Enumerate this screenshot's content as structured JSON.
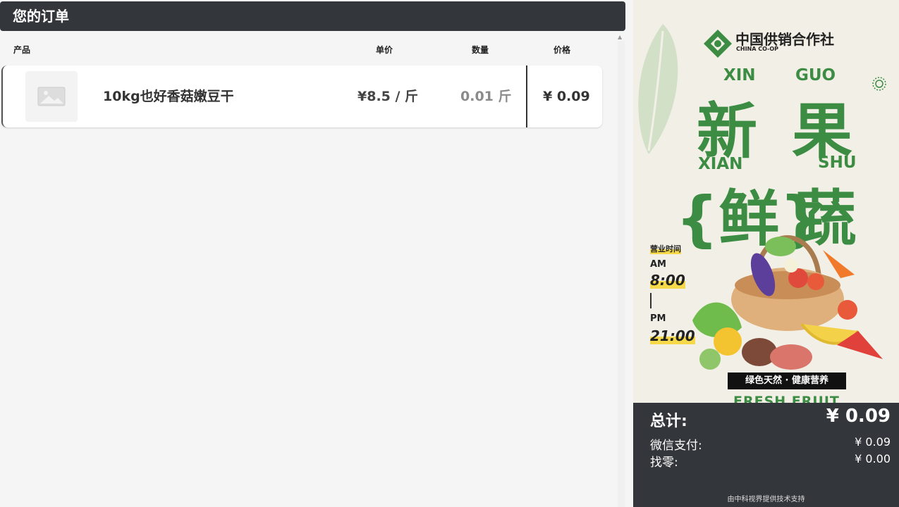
{
  "order": {
    "title": "您的订单",
    "columns": {
      "product": "产品",
      "unit_price": "单价",
      "quantity": "数量",
      "price": "价格"
    },
    "items": [
      {
        "name": "10kg也好香菇嫩豆干",
        "unit_price": "¥8.5 / 斤",
        "quantity": "0.01 斤",
        "price": "¥ 0.09",
        "image_icon": "image-placeholder-icon"
      }
    ]
  },
  "poster": {
    "brand_cn": "中国供销合作社",
    "brand_en": "CHINA CO-OP",
    "pinyin_xin": "XIN",
    "pinyin_guo": "GUO",
    "char_xin": "新",
    "char_guo": "果",
    "pinyin_xian": "XIAN",
    "pinyin_shu": "SHU",
    "char_xian": "{鲜}",
    "char_shu": "蔬",
    "hours_title": "营业时间",
    "am_label": "AM",
    "am_time": "8:00",
    "pm_label": "PM",
    "pm_time": "21:00",
    "slogan": "绿色天然 · 健康营养",
    "fresh_fruit": "FRESH FRUIT",
    "accent_color": "#3d8c44"
  },
  "summary": {
    "total_label": "总计:",
    "total_value": "¥ 0.09",
    "wechat_label": "微信支付:",
    "wechat_value": "¥ 0.09",
    "change_label": "找零:",
    "change_value": "¥ 0.00",
    "footer_note": "由中科视界提供技术支持"
  }
}
